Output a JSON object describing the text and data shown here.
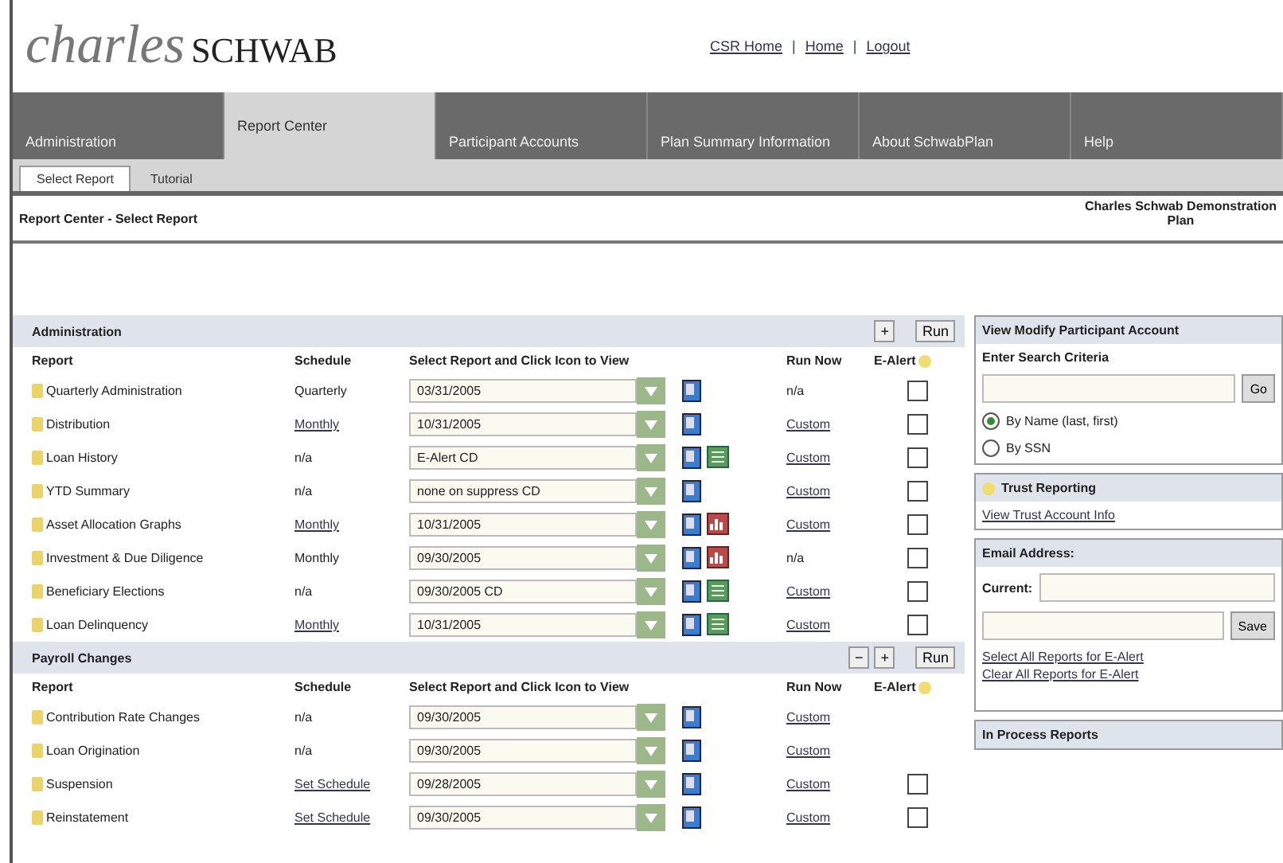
{
  "logo": {
    "first": "charles",
    "second": "SCHWAB"
  },
  "top_links": [
    {
      "kind": "link",
      "label": "CSR Home"
    },
    {
      "kind": "separator",
      "label": "|"
    },
    {
      "kind": "link",
      "label": "Home"
    },
    {
      "kind": "separator",
      "label": "|"
    },
    {
      "kind": "link",
      "label": "Logout"
    }
  ],
  "tabs": [
    {
      "label": "Administration",
      "selected": false
    },
    {
      "label": "Report Center",
      "selected": true
    },
    {
      "label": "Participant Accounts",
      "selected": false
    },
    {
      "label": "Plan Summary Information",
      "selected": false
    },
    {
      "label": "About SchwabPlan",
      "selected": false
    },
    {
      "label": "Help",
      "selected": false
    }
  ],
  "subtabs": [
    {
      "label": "Select Report",
      "selected": true
    },
    {
      "label": "Tutorial",
      "selected": false
    }
  ],
  "page_title": "Report Center - Select Report",
  "plan_name": [
    "Charles Schwab Demonstration",
    "Plan"
  ],
  "sections": [
    {
      "title": "Administration",
      "header_buttons": [
        "+"
      ],
      "run_button": "Run",
      "columns": [
        "Report",
        "Schedule",
        "Select Report and Click Icon to View",
        "Run Now",
        "E-Alert"
      ],
      "rows": [
        {
          "report": "Quarterly Administration",
          "schedule": "Quarterly",
          "schedule_link": false,
          "select": "03/31/2005",
          "icons": [
            {
              "kind": "document"
            }
          ],
          "run_now": "n/a",
          "run_link": false,
          "e_alert": true,
          "checked": false
        },
        {
          "report": "Distribution",
          "schedule": "Monthly",
          "schedule_link": true,
          "select": "10/31/2005",
          "icons": [
            {
              "kind": "document"
            }
          ],
          "run_now": "Custom",
          "run_link": true,
          "e_alert": true,
          "checked": false
        },
        {
          "report": "Loan History",
          "schedule": "n/a",
          "schedule_link": false,
          "select": "E-Alert CD",
          "icons": [
            {
              "kind": "document"
            },
            {
              "kind": "spreadsheet"
            }
          ],
          "run_now": "Custom",
          "run_link": true,
          "e_alert": true,
          "checked": false
        },
        {
          "report": "YTD Summary",
          "schedule": "n/a",
          "schedule_link": false,
          "select": "none on suppress CD",
          "icons": [
            {
              "kind": "document"
            }
          ],
          "run_now": "Custom",
          "run_link": true,
          "e_alert": true,
          "checked": false
        },
        {
          "report": "Asset Allocation Graphs",
          "schedule": "Monthly",
          "schedule_link": true,
          "select": "10/31/2005",
          "icons": [
            {
              "kind": "document"
            },
            {
              "kind": "chart"
            }
          ],
          "run_now": "Custom",
          "run_link": true,
          "e_alert": true,
          "checked": false
        },
        {
          "report": "Investment & Due Diligence",
          "schedule": "Monthly",
          "schedule_link": false,
          "select": "09/30/2005",
          "icons": [
            {
              "kind": "document"
            },
            {
              "kind": "chart"
            }
          ],
          "run_now": "n/a",
          "run_link": false,
          "e_alert": true,
          "checked": false
        },
        {
          "report": "Beneficiary Elections",
          "schedule": "n/a",
          "schedule_link": false,
          "select": "09/30/2005 CD",
          "icons": [
            {
              "kind": "document"
            },
            {
              "kind": "spreadsheet"
            }
          ],
          "run_now": "Custom",
          "run_link": true,
          "e_alert": true,
          "checked": false
        },
        {
          "report": "Loan Delinquency",
          "schedule": "Monthly",
          "schedule_link": true,
          "select": "10/31/2005",
          "icons": [
            {
              "kind": "document"
            },
            {
              "kind": "spreadsheet"
            }
          ],
          "run_now": "Custom",
          "run_link": true,
          "e_alert": true,
          "checked": false
        }
      ]
    },
    {
      "title": "Payroll Changes",
      "header_buttons": [
        "−",
        "+"
      ],
      "run_button": "Run",
      "columns": [
        "Report",
        "Schedule",
        "Select Report and Click Icon to View",
        "Run Now",
        "E-Alert"
      ],
      "rows": [
        {
          "report": "Contribution Rate Changes",
          "schedule": "n/a",
          "schedule_link": false,
          "select": "09/30/2005",
          "icons": [
            {
              "kind": "document"
            }
          ],
          "run_now": "Custom",
          "run_link": true,
          "e_alert": false
        },
        {
          "report": "Loan Origination",
          "schedule": "n/a",
          "schedule_link": false,
          "select": "09/30/2005",
          "icons": [
            {
              "kind": "document"
            }
          ],
          "run_now": "Custom",
          "run_link": true,
          "e_alert": false
        },
        {
          "report": "Suspension",
          "schedule": "Set Schedule",
          "schedule_link": true,
          "select": "09/28/2005",
          "icons": [
            {
              "kind": "document"
            }
          ],
          "run_now": "Custom",
          "run_link": true,
          "e_alert": true,
          "checked": false
        },
        {
          "report": "Reinstatement",
          "schedule": "Set Schedule",
          "schedule_link": true,
          "select": "09/30/2005",
          "icons": [
            {
              "kind": "document"
            }
          ],
          "run_now": "Custom",
          "run_link": true,
          "e_alert": true,
          "checked": false
        }
      ]
    }
  ],
  "participant_panel": {
    "title": "View Modify Participant Account",
    "subtitle": "Enter Search Criteria",
    "go_button": "Go",
    "options": [
      {
        "label": "By Name (last, first)",
        "selected": true
      },
      {
        "label": "By SSN",
        "selected": false
      }
    ]
  },
  "trust_panel": {
    "title": "Trust Reporting",
    "link": "View Trust Account Info"
  },
  "email_panel": {
    "title": "Email Address:",
    "current_label": "Current:",
    "save_button": "Save",
    "links": [
      "Select All Reports for E-Alert",
      "Clear All Reports for E-Alert"
    ]
  },
  "in_process_panel": {
    "title": "In Process Reports"
  }
}
